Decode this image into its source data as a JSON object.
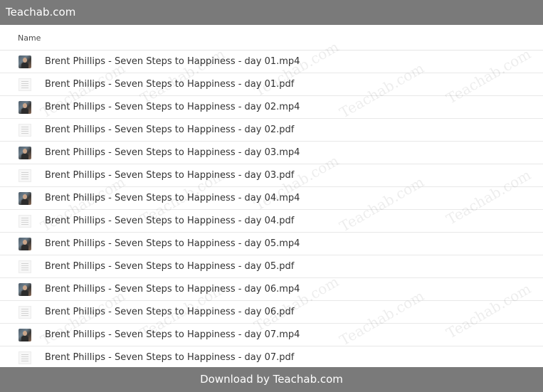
{
  "topbar": {
    "title": "Teachab.com"
  },
  "table": {
    "column_name": "Name"
  },
  "files": [
    {
      "name": "Brent Phillips - Seven Steps to Happiness - day 01.mp4",
      "type": "video"
    },
    {
      "name": "Brent Phillips - Seven Steps to Happiness - day 01.pdf",
      "type": "pdf"
    },
    {
      "name": "Brent Phillips - Seven Steps to Happiness - day 02.mp4",
      "type": "video"
    },
    {
      "name": "Brent Phillips - Seven Steps to Happiness - day 02.pdf",
      "type": "pdf"
    },
    {
      "name": "Brent Phillips - Seven Steps to Happiness - day 03.mp4",
      "type": "video"
    },
    {
      "name": "Brent Phillips - Seven Steps to Happiness - day 03.pdf",
      "type": "pdf"
    },
    {
      "name": "Brent Phillips - Seven Steps to Happiness - day 04.mp4",
      "type": "video"
    },
    {
      "name": "Brent Phillips - Seven Steps to Happiness - day 04.pdf",
      "type": "pdf"
    },
    {
      "name": "Brent Phillips - Seven Steps to Happiness - day 05.mp4",
      "type": "video"
    },
    {
      "name": "Brent Phillips - Seven Steps to Happiness - day 05.pdf",
      "type": "pdf"
    },
    {
      "name": "Brent Phillips - Seven Steps to Happiness - day 06.mp4",
      "type": "video"
    },
    {
      "name": "Brent Phillips - Seven Steps to Happiness - day 06.pdf",
      "type": "pdf"
    },
    {
      "name": "Brent Phillips - Seven Steps to Happiness - day 07.mp4",
      "type": "video"
    },
    {
      "name": "Brent Phillips - Seven Steps to Happiness - day 07.pdf",
      "type": "pdf"
    }
  ],
  "watermark": {
    "text": "Teachab.com"
  },
  "footer": {
    "text": "Download by Teachab.com"
  },
  "colors": {
    "bar": "#7a7a7a",
    "text": "#333333",
    "divider": "#e8e8e8"
  }
}
